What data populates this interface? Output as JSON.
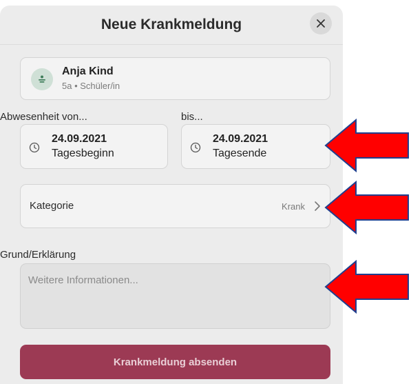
{
  "dialog": {
    "title": "Neue Krankmeldung"
  },
  "student": {
    "name": "Anja Kind",
    "details": "5a • Schüler/in"
  },
  "absence": {
    "from_label": "Abwesenheit von...",
    "to_label": "bis...",
    "from_date": "24.09.2021",
    "from_time": "Tagesbeginn",
    "to_date": "24.09.2021",
    "to_time": "Tagesende"
  },
  "category": {
    "label": "Kategorie",
    "value": "Krank"
  },
  "reason": {
    "label": "Grund/Erklärung",
    "placeholder": "Weitere Informationen..."
  },
  "submit": {
    "label": "Krankmeldung absenden"
  },
  "colors": {
    "accent": "#9c3a54",
    "annotation_arrow": "#ff0000"
  },
  "icons": [
    "close-icon",
    "student-icon",
    "clock-icon",
    "chevron-right-icon",
    "arrow-left-icon"
  ]
}
